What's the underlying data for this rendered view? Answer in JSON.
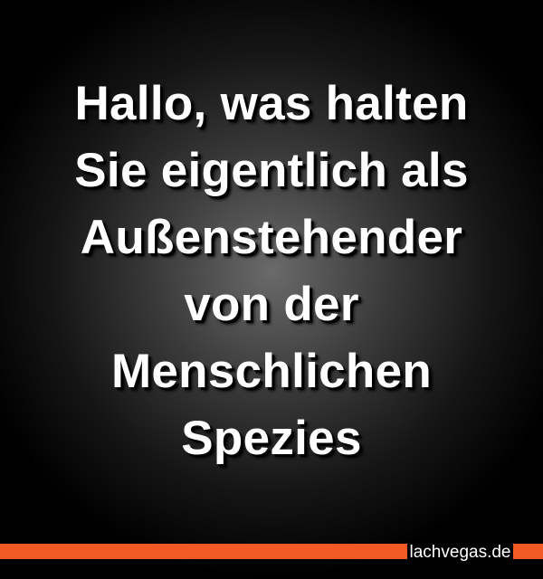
{
  "quote": {
    "lines": [
      "Hallo, was halten",
      "Sie eigentlich als",
      "Außenstehender",
      "von der",
      "Menschlichen",
      "Spezies"
    ]
  },
  "footer": {
    "site": "lachvegas.de"
  },
  "colors": {
    "background": "#000000",
    "accent_bar": "#f15a24",
    "text": "#ffffff"
  }
}
